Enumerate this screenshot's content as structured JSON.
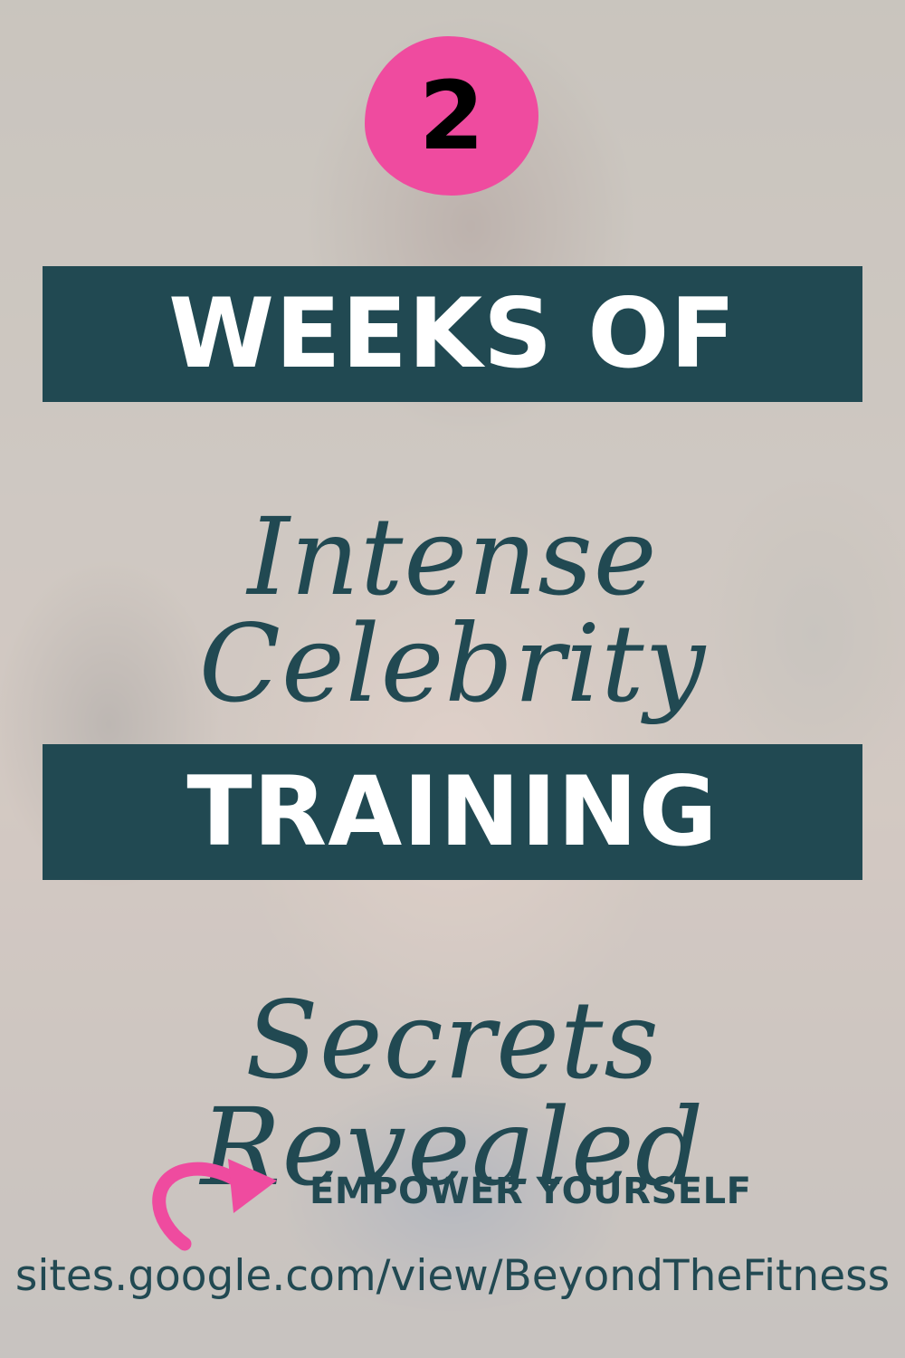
{
  "badge": {
    "number": "2"
  },
  "banner_top": {
    "text": "WEEKS OF"
  },
  "script_top": {
    "text": "Intense Celebrity"
  },
  "banner_bottom": {
    "text": "TRAINING"
  },
  "script_bottom": {
    "text": "Secrets Revealed"
  },
  "tagline": {
    "text": "EMPOWER YOURSELF"
  },
  "url": {
    "text": "sites.google.com/view/BeyondTheFitness"
  },
  "colors": {
    "accent_pink": "#ef4b9f",
    "teal_dark": "#214952",
    "white": "#ffffff"
  },
  "icons": {
    "arrow": "curved-arrow-icon"
  }
}
